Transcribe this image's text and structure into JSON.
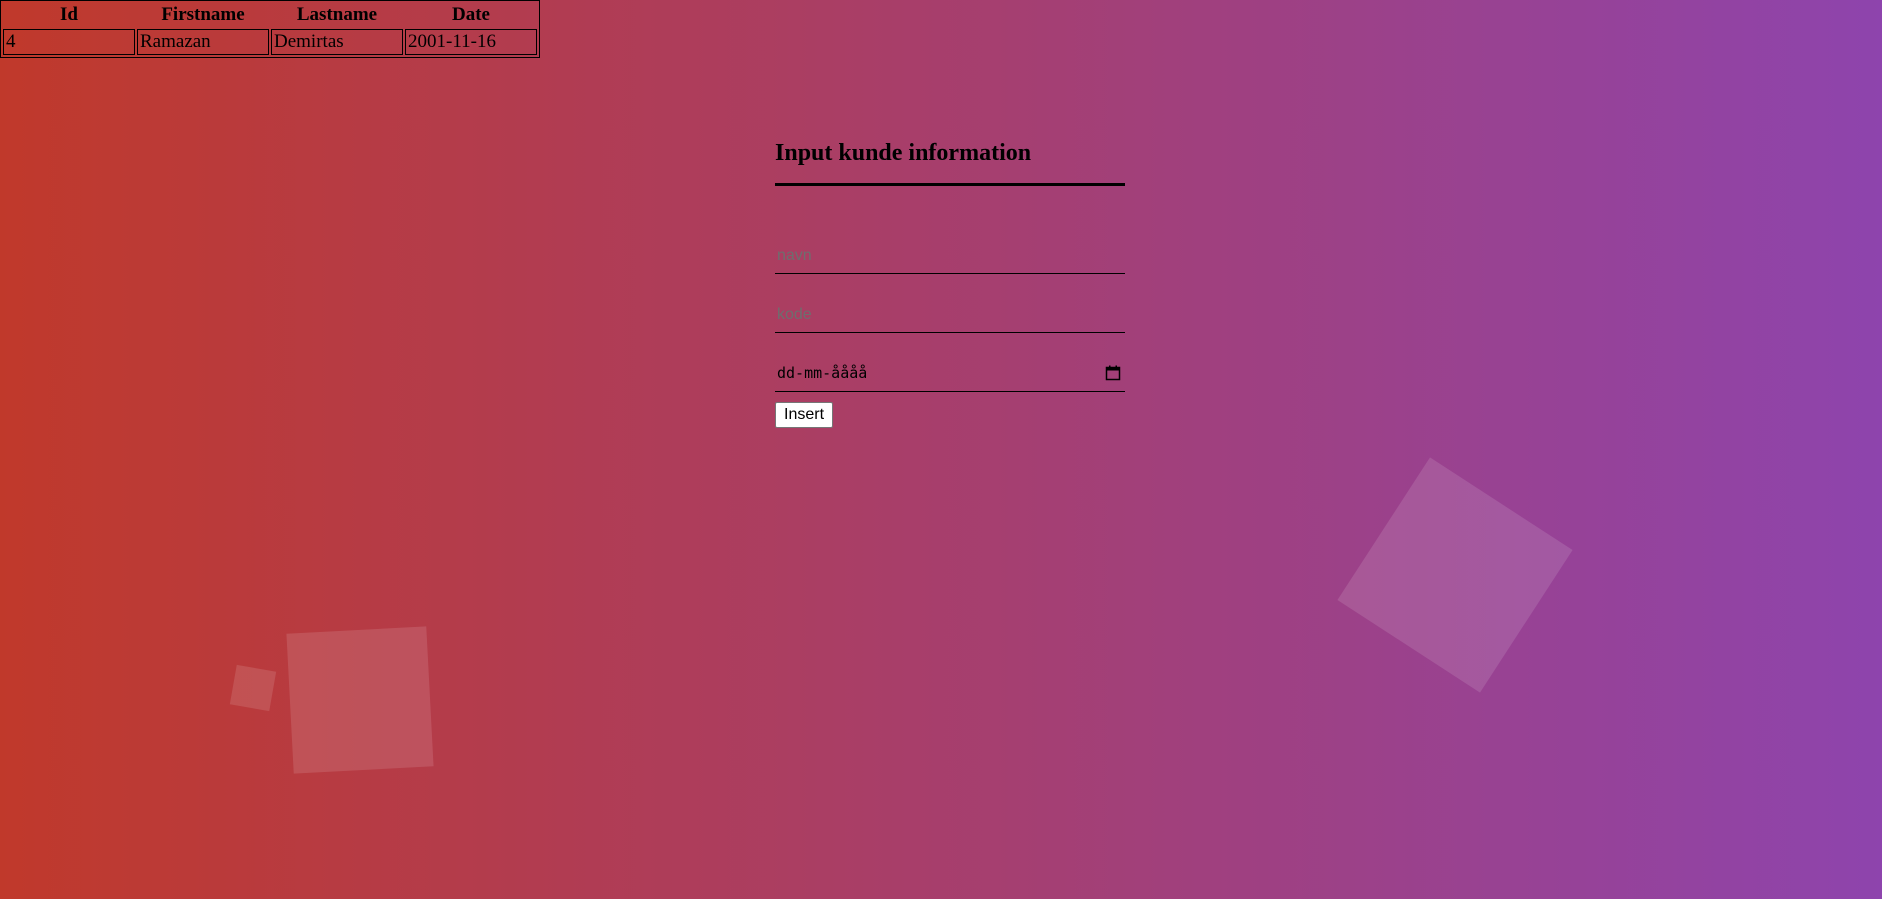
{
  "table": {
    "headers": [
      "Id",
      "Firstname",
      "Lastname",
      "Date"
    ],
    "rows": [
      [
        "4",
        "Ramazan",
        "Demirtas",
        "2001-11-16"
      ]
    ]
  },
  "form": {
    "title": "Input kunde information",
    "name_placeholder": "navn",
    "code_placeholder": "kode",
    "date_placeholder": "dd-mm-åååå",
    "insert_label": "Insert"
  },
  "icons": {
    "date_picker": "calendar-icon"
  },
  "colors": {
    "gradient_start": "#c0392b",
    "gradient_end": "#8e44ad"
  }
}
